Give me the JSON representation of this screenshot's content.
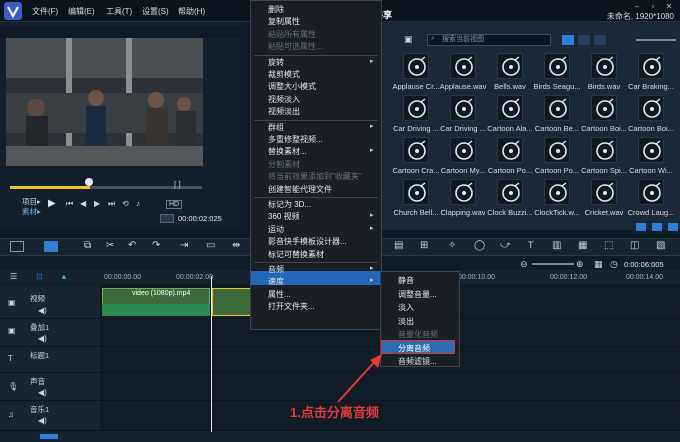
{
  "app": {
    "title": "未命名, 1920*1080"
  },
  "menu": [
    "文件(F)",
    "编辑(E)",
    "工具(T)",
    "设置(S)",
    "帮助(H)"
  ],
  "tabs": {
    "share": "共享"
  },
  "preview": {
    "mode_project": "项目▸",
    "mode_clip": "素材▸",
    "timecode": "00:00:02:025",
    "hd": "HD"
  },
  "library": {
    "search_placeholder": "搜索当前视图",
    "items": [
      "Applause Cr...",
      "Applause.wav",
      "Bells.wav",
      "Birds Seagu...",
      "Birds.wav",
      "Car Braking...",
      "Car Driving ...",
      "Car Driving ...",
      "Cartoon Ala...",
      "Cartoon Be...",
      "Cartoon Boi...",
      "Cartoon Boi...",
      "Cartoon Cra...",
      "Cartoon My...",
      "Cartoon Po...",
      "Cartoon Po...",
      "Cartoon Spi...",
      "Cartoon Wi...",
      "Church Bell...",
      "Clapping.wav",
      "Clock Buzzi...",
      "ClockTick.w...",
      "Cricket.wav",
      "Crowd Laug..."
    ]
  },
  "timeline": {
    "ruler": [
      "00:00:00.00",
      "00:00:02.00",
      "00:00:10.00",
      "00:00:12.00",
      "00:00:14.00"
    ],
    "zoom_time": "0:00:06:005",
    "tracks": [
      "视频",
      "叠加1",
      "标题1",
      "声音",
      "音乐1"
    ],
    "clip_label": "video (1080p).mp4"
  },
  "context_menu": {
    "items": [
      {
        "label": "删除",
        "disabled": false,
        "arrow": false
      },
      {
        "label": "复制属性",
        "disabled": false,
        "arrow": false
      },
      {
        "label": "粘贴所有属性",
        "disabled": true,
        "arrow": false
      },
      {
        "label": "粘贴可选属性...",
        "disabled": true,
        "arrow": false
      },
      {
        "label": "旋转",
        "disabled": false,
        "arrow": true
      },
      {
        "label": "裁剪模式",
        "disabled": false,
        "arrow": false
      },
      {
        "label": "调整大小模式",
        "disabled": false,
        "arrow": false
      },
      {
        "label": "视频淡入",
        "disabled": false,
        "arrow": false
      },
      {
        "label": "视频淡出",
        "disabled": false,
        "arrow": false
      },
      {
        "label": "群组",
        "disabled": false,
        "arrow": true
      },
      {
        "label": "多重修整视频...",
        "disabled": false,
        "arrow": false
      },
      {
        "label": "替换素材...",
        "disabled": false,
        "arrow": true
      },
      {
        "label": "分割素材",
        "disabled": true,
        "arrow": false
      },
      {
        "label": "将当前效果添加到\"收藏夹\"",
        "disabled": true,
        "arrow": false
      },
      {
        "label": "创建智能代理文件",
        "disabled": false,
        "arrow": false
      },
      {
        "label": "标记为 3D...",
        "disabled": false,
        "arrow": false
      },
      {
        "label": "360 视频",
        "disabled": false,
        "arrow": true
      },
      {
        "label": "运动",
        "disabled": false,
        "arrow": true
      },
      {
        "label": "影音快手模板设计器...",
        "disabled": false,
        "arrow": false
      },
      {
        "label": "标记可替换素材",
        "disabled": false,
        "arrow": false
      },
      {
        "label": "音频",
        "disabled": false,
        "arrow": true,
        "highlighted": true
      },
      {
        "label": "速度",
        "disabled": false,
        "arrow": true
      },
      {
        "label": "属性...",
        "disabled": false,
        "arrow": false
      },
      {
        "label": "打开文件夹...",
        "disabled": false,
        "arrow": false
      }
    ]
  },
  "audio_submenu": {
    "items": [
      {
        "label": "静音",
        "disabled": false
      },
      {
        "label": "调整音量...",
        "disabled": false
      },
      {
        "label": "淡入",
        "disabled": false
      },
      {
        "label": "淡出",
        "disabled": false
      },
      {
        "label": "音量化音频",
        "disabled": true
      },
      {
        "label": "分离音频",
        "disabled": false,
        "highlighted": true
      },
      {
        "label": "音频滤镜...",
        "disabled": false
      }
    ]
  },
  "annotation": {
    "text": "1.点击分离音频"
  },
  "colors": {
    "accent": "#2368b8",
    "callout": "#e13a3a"
  }
}
